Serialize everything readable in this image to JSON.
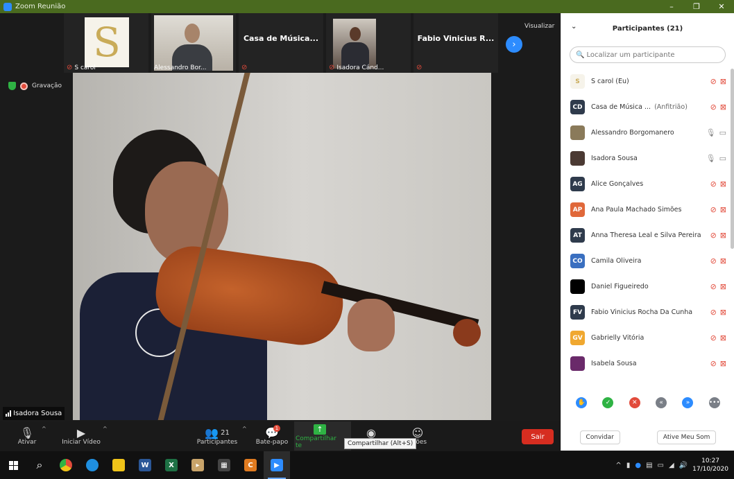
{
  "window": {
    "title": "Zoom Reunião",
    "controls": [
      "–",
      "❐",
      "✕"
    ]
  },
  "thumbnails": [
    {
      "kind": "logo",
      "logo_text": "S",
      "name": "S carol"
    },
    {
      "kind": "camera",
      "name": "Alessandro Bor..."
    },
    {
      "kind": "text",
      "big_name": "Casa de Música...",
      "name": ""
    },
    {
      "kind": "camera",
      "name": "Isadora Cánd..."
    },
    {
      "kind": "text",
      "big_name": "Fabio Vinicius R...",
      "name": ""
    }
  ],
  "gallery": {
    "view_label": "Visualizar",
    "next_icon": "›"
  },
  "meeting": {
    "recording_label": "Gravação",
    "active_speaker": "Isadora Sousa"
  },
  "toolbar": {
    "mute": "Ativar",
    "video": "Iniciar Vídeo",
    "participants": "Participantes",
    "participants_count": "21",
    "chat": "Bate-papo",
    "chat_badge": "1",
    "share": "Compartilhar te",
    "record_suffix": "ações",
    "share_tooltip": "Compartilhar (Alt+S)",
    "leave": "Sair"
  },
  "panel": {
    "title": "Participantes (21)",
    "search_placeholder": "Localizar um participante",
    "participants": [
      {
        "initials": "S",
        "color": "#f6f3ea",
        "text_color": "#c9ab58",
        "name": "S carol (Eu)",
        "host": "",
        "audio": "muted",
        "video": "off"
      },
      {
        "initials": "CD",
        "color": "#2f3b4c",
        "text_color": "#ffffff",
        "name": "Casa de Música ...",
        "host": "(Anfitrião)",
        "audio": "muted",
        "video": "off"
      },
      {
        "initials": "",
        "color": "#8a7a5a",
        "text_color": "#ffffff",
        "name": "Alessandro Borgomanero",
        "host": "",
        "audio": "on",
        "video": "on"
      },
      {
        "initials": "",
        "color": "#4b3a33",
        "text_color": "#ffffff",
        "name": "Isadora Sousa",
        "host": "",
        "audio": "on",
        "video": "on"
      },
      {
        "initials": "AG",
        "color": "#2f3b4c",
        "text_color": "#ffffff",
        "name": "Alice Gonçalves",
        "host": "",
        "audio": "muted",
        "video": "off"
      },
      {
        "initials": "AP",
        "color": "#e0683a",
        "text_color": "#ffffff",
        "name": "Ana Paula Machado Simões",
        "host": "",
        "audio": "muted",
        "video": "off"
      },
      {
        "initials": "AT",
        "color": "#2f3b4c",
        "text_color": "#ffffff",
        "name": "Anna Theresa Leal e Silva Pereira",
        "host": "",
        "audio": "muted",
        "video": "off"
      },
      {
        "initials": "CO",
        "color": "#3a6fc0",
        "text_color": "#ffffff",
        "name": "Camila Oliveira",
        "host": "",
        "audio": "muted",
        "video": "off"
      },
      {
        "initials": "",
        "color": "#000000",
        "text_color": "#ffffff",
        "name": "Daniel Figueiredo",
        "host": "",
        "audio": "muted",
        "video": "off"
      },
      {
        "initials": "FV",
        "color": "#2f3b4c",
        "text_color": "#ffffff",
        "name": "Fabio Vinicius Rocha Da Cunha",
        "host": "",
        "audio": "muted",
        "video": "off"
      },
      {
        "initials": "GV",
        "color": "#f0a830",
        "text_color": "#ffffff",
        "name": "Gabrielly Vitória",
        "host": "",
        "audio": "muted",
        "video": "off"
      },
      {
        "initials": "",
        "color": "#6a2a6a",
        "text_color": "#ffffff",
        "name": "Isabela Sousa",
        "host": "",
        "audio": "muted",
        "video": "off"
      }
    ],
    "reactions": [
      {
        "name": "raise-hand-icon",
        "glyph": "✋",
        "color": "#2d8cff"
      },
      {
        "name": "yes-icon",
        "glyph": "✓",
        "color": "#2fb344"
      },
      {
        "name": "no-icon",
        "glyph": "✕",
        "color": "#e24b3b"
      },
      {
        "name": "go-slower-icon",
        "glyph": "«",
        "color": "#7a7f87"
      },
      {
        "name": "go-faster-icon",
        "glyph": "»",
        "color": "#2d8cff"
      },
      {
        "name": "more-icon",
        "glyph": "•••",
        "color": "#7a7f87"
      }
    ],
    "invite": "Convidar",
    "unmute_me": "Ative Meu Som"
  },
  "taskbar": {
    "time": "10:27",
    "date": "17/10/2020"
  }
}
